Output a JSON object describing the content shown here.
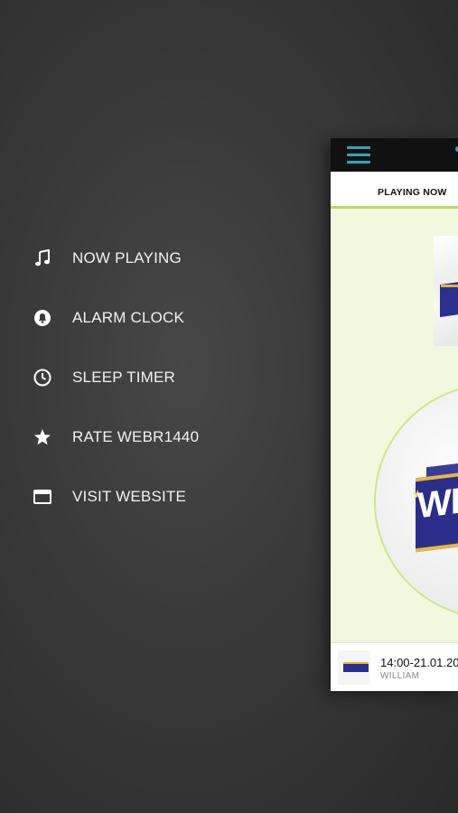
{
  "menu": {
    "items": [
      {
        "label": "NOW PLAYING",
        "icon": "music-note-icon"
      },
      {
        "label": "ALARM CLOCK",
        "icon": "alarm-bell-icon"
      },
      {
        "label": "SLEEP TIMER",
        "icon": "clock-icon"
      },
      {
        "label": "RATE WEBR1440",
        "icon": "star-icon"
      },
      {
        "label": "VISIT WEBSITE",
        "icon": "browser-window-icon"
      }
    ]
  },
  "app": {
    "tab_label": "PLAYING NOW",
    "logo_text": "WEB",
    "now_playing": {
      "title": "14:00-21.01.20",
      "artist": "WILLIAM"
    }
  },
  "colors": {
    "accent": "#2fa7b8",
    "tab_underline": "#b8d96a",
    "panel_bg": "#f1f8dd",
    "logo_blue": "#2c2d8a",
    "logo_gold": "#e5b93c"
  }
}
